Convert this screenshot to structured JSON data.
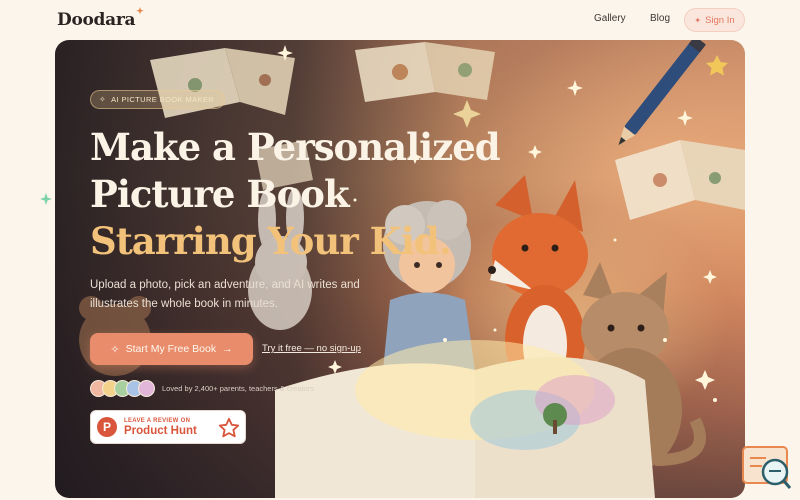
{
  "brand": {
    "name": "Doodara",
    "accent": "#e8884e"
  },
  "nav": {
    "links": [
      {
        "label": "Gallery"
      },
      {
        "label": "Blog"
      }
    ],
    "signin_label": "Sign In"
  },
  "hero": {
    "badge": "AI PICTURE BOOK MAKER",
    "headline_line1": "Make a Personalized",
    "headline_line2": "Picture Book",
    "headline_highlight": "Starring Your Kid.",
    "subtitle": "Upload a photo, pick an adventure, and AI writes and illustrates the whole book in minutes.",
    "cta_label": "Start My Free Book",
    "secondary_link": "Try it free — no sign-up",
    "social_proof": "Loved by 2,400+ parents, teachers & creators",
    "product_hunt": {
      "small": "LEAVE A REVIEW ON",
      "big": "Product Hunt"
    }
  },
  "colors": {
    "cta": "#e98c6b",
    "highlight": "#f3c27a",
    "product_hunt": "#d9553b",
    "background": "#fbf5ec"
  },
  "icons": [
    "sparkle-icon",
    "arrow-right-icon",
    "product-hunt-icon",
    "star-icon",
    "chat-widget-icon"
  ]
}
